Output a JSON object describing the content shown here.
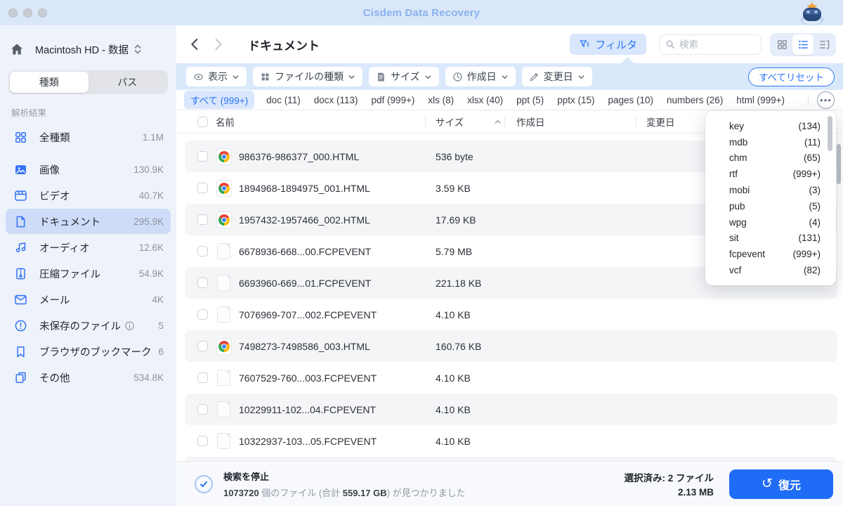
{
  "colors": {
    "accent": "#2e77f6",
    "recover-blue": "#1f6cf6",
    "icon-blue": "#3273f5",
    "titlebar-bg": "#d9e7f8",
    "title-text": "#8ab2ee",
    "sidebar-bg": "#eef2fa",
    "selected-item-bg": "#cfdcf8",
    "filter-row-bg": "#d9e8fb",
    "tab-pill-bg": "#d9e6fc",
    "row-alt-bg": "#f4f5f7",
    "statusbar-bg": "#f7f9fc"
  },
  "window": {
    "title": "Cisdem Data Recovery"
  },
  "sidebar": {
    "device": "Macintosh HD - 数据",
    "tabs": [
      {
        "label": "種類",
        "active": true
      },
      {
        "label": "パス",
        "active": false
      }
    ],
    "section": "解析結果",
    "items": [
      {
        "icon": "alltypes",
        "label": "全種類",
        "count": "1.1M"
      },
      {
        "icon": "image",
        "label": "画像",
        "count": "130.9K",
        "gap": true
      },
      {
        "icon": "video",
        "label": "ビデオ",
        "count": "40.7K"
      },
      {
        "icon": "document",
        "label": "ドキュメント",
        "count": "295.9K",
        "active": true
      },
      {
        "icon": "audio",
        "label": "オーディオ",
        "count": "12.6K"
      },
      {
        "icon": "archive",
        "label": "圧縮ファイル",
        "count": "54.9K"
      },
      {
        "icon": "mail",
        "label": "メール",
        "count": "4K"
      },
      {
        "icon": "unsaved",
        "label": "未保存のファイル",
        "count": "5",
        "info": true
      },
      {
        "icon": "bookmark",
        "label": "ブラウザのブックマーク",
        "count": "6"
      },
      {
        "icon": "other",
        "label": "その他",
        "count": "534.8K"
      }
    ]
  },
  "toolbar": {
    "title": "ドキュメント",
    "filter_label": "フィルタ",
    "search_placeholder": "検索"
  },
  "filters": {
    "chips": [
      {
        "icon": "eye",
        "label": "表示"
      },
      {
        "icon": "types",
        "label": "ファイルの種類"
      },
      {
        "icon": "size",
        "label": "サイズ"
      },
      {
        "icon": "created",
        "label": "作成日"
      },
      {
        "icon": "modified",
        "label": "変更日"
      }
    ],
    "reset_label": "すべてリセット"
  },
  "type_tabs": {
    "items": [
      {
        "label": "すべて (999+)",
        "active": true
      },
      {
        "label": "doc (11)"
      },
      {
        "label": "docx (113)"
      },
      {
        "label": "pdf (999+)"
      },
      {
        "label": "xls (8)"
      },
      {
        "label": "xlsx (40)"
      },
      {
        "label": "ppt (5)"
      },
      {
        "label": "pptx (15)"
      },
      {
        "label": "pages (10)"
      },
      {
        "label": "numbers (26)"
      },
      {
        "label": "html (999+)"
      }
    ],
    "more_label": "•••"
  },
  "dropdown": {
    "items": [
      {
        "name": "key",
        "count": "(134)"
      },
      {
        "name": "mdb",
        "count": "(11)"
      },
      {
        "name": "chm",
        "count": "(65)"
      },
      {
        "name": "rtf",
        "count": "(999+)"
      },
      {
        "name": "mobi",
        "count": "(3)"
      },
      {
        "name": "pub",
        "count": "(5)"
      },
      {
        "name": "wpg",
        "count": "(4)"
      },
      {
        "name": "sit",
        "count": "(131)"
      },
      {
        "name": "fcpevent",
        "count": "(999+)"
      },
      {
        "name": "vcf",
        "count": "(82)"
      }
    ]
  },
  "table": {
    "columns": {
      "name": "名前",
      "size": "サイズ",
      "created": "作成日",
      "modified": "変更日"
    },
    "rows": [
      {
        "icon": "html",
        "name": "986376-986377_000.HTML",
        "size": "536 byte"
      },
      {
        "icon": "html",
        "name": "1894968-1894975_001.HTML",
        "size": "3.59 KB"
      },
      {
        "icon": "html",
        "name": "1957432-1957466_002.HTML",
        "size": "17.69 KB"
      },
      {
        "icon": "file",
        "name": "6678936-668...00.FCPEVENT",
        "size": "5.79 MB"
      },
      {
        "icon": "file",
        "name": "6693960-669...01.FCPEVENT",
        "size": "221.18 KB"
      },
      {
        "icon": "file",
        "name": "7076969-707...002.FCPEVENT",
        "size": "4.10 KB"
      },
      {
        "icon": "html",
        "name": "7498273-7498586_003.HTML",
        "size": "160.76 KB"
      },
      {
        "icon": "file",
        "name": "7607529-760...003.FCPEVENT",
        "size": "4.10 KB"
      },
      {
        "icon": "file",
        "name": "10229911-102...04.FCPEVENT",
        "size": "4.10 KB"
      },
      {
        "icon": "file",
        "name": "10322937-103...05.FCPEVENT",
        "size": "4.10 KB"
      }
    ]
  },
  "statusbar": {
    "stop_label": "検索を停止",
    "found_count": "1073720",
    "found_mid": " 個のファイル (合計 ",
    "found_size": "559.17 GB",
    "found_tail": ") が見つかりました",
    "selected_label": "選択済み: 2 ファイル",
    "selected_size": "2.13 MB",
    "recover_label": "復元"
  }
}
